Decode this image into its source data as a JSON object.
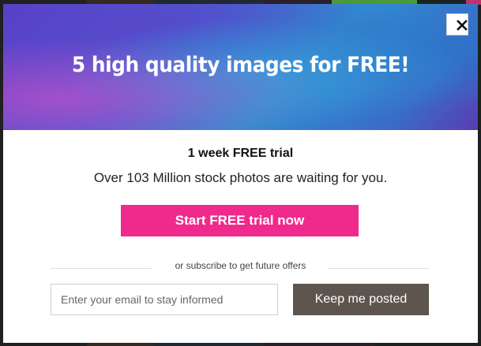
{
  "modal": {
    "hero_title": "5 high quality images for FREE!",
    "close_label": "✕",
    "trial_heading": "1 week FREE trial",
    "trial_subtitle": "Over 103 Million stock photos are waiting for you.",
    "cta_label": "Start FREE trial now",
    "divider_text": "or subscribe to get future offers",
    "email_input": {
      "value": "",
      "placeholder": "Enter your email to stay informed"
    },
    "subscribe_label": "Keep me posted"
  },
  "icons": {
    "close": "close-icon"
  },
  "colors": {
    "cta": "#f02a8c",
    "subscribe": "#5e554e",
    "hero_gradient": [
      "#5a3cc8",
      "#2f8fd0",
      "#5a3cb0"
    ]
  }
}
